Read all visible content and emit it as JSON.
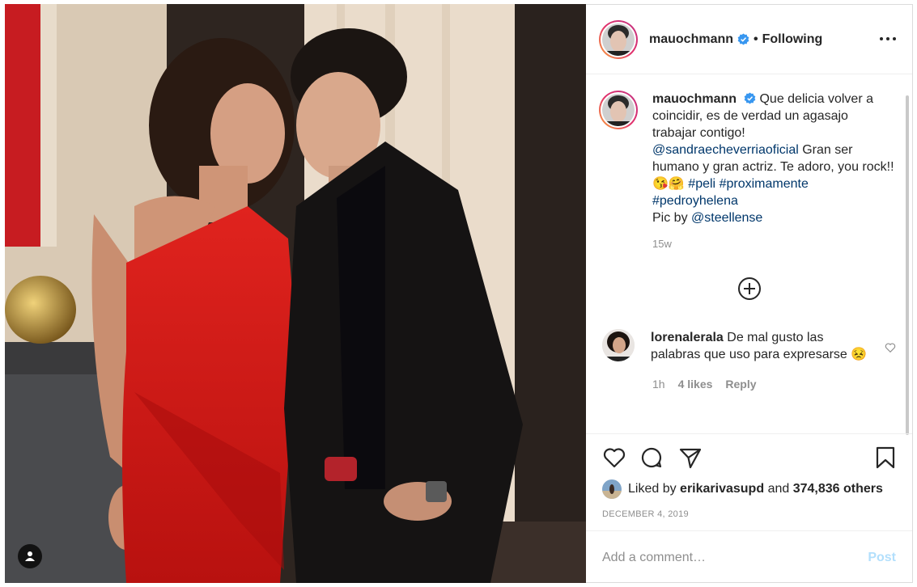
{
  "post": {
    "username": "mauochmann",
    "follow_separator": "•",
    "follow_status": "Following"
  },
  "caption": {
    "username": "mauochmann",
    "text1": "Que delicia volver a coincidir, es de verdad un agasajo trabajar contigo!",
    "mention1": "@sandraecheverriaoficial",
    "text2": "Gran ser humano y gran actriz. Te adoro, you rock!! 😘🤗",
    "hashtag1": "#peli",
    "hashtag2": "#proximamente",
    "hashtag3": "#pedroyhelena",
    "text3": "Pic by",
    "mention2": "@steellense",
    "timestamp": "15w"
  },
  "comment": {
    "username": "lorenalerala",
    "text": "De mal gusto las palabras que uso para expresarse 😣",
    "time": "1h",
    "likes": "4 likes",
    "reply": "Reply"
  },
  "likes": {
    "prefix": "Liked by",
    "user": "erikarivasupd",
    "conj": "and",
    "count": "374,836 others"
  },
  "date": "DECEMBER 4, 2019",
  "add_comment": {
    "placeholder": "Add a comment…",
    "post_label": "Post"
  },
  "colors": {
    "accent_link": "#00376b",
    "verified_blue": "#3897f0",
    "post_disabled": "#b2dffc",
    "dress_red": "#d8191c"
  },
  "icons": [
    "more-icon",
    "verified-icon",
    "load-more-icon",
    "heart-icon",
    "comment-icon",
    "share-icon",
    "bookmark-icon",
    "user-tag-icon"
  ]
}
